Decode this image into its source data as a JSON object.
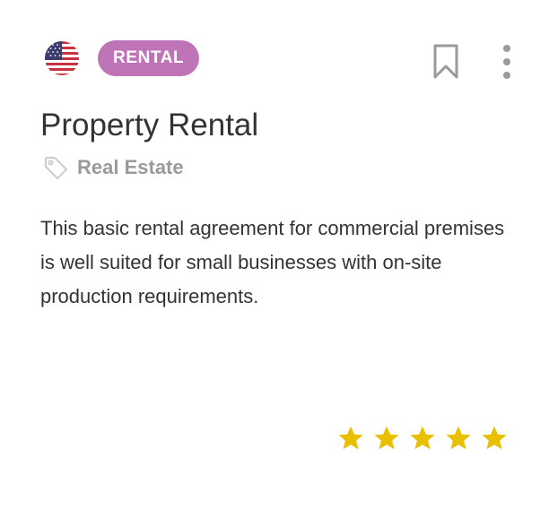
{
  "card": {
    "flag_icon": "us-flag-icon",
    "badge_label": "RENTAL",
    "title": "Property Rental",
    "category": "Real Estate",
    "description": "This basic rental agreement for commercial premises is well suited for small businesses with on-site production requirements.",
    "rating": {
      "value": 5,
      "max": 5
    }
  },
  "colors": {
    "badge": "#c074b8",
    "star": "#e8c000",
    "icon_gray": "#9a9a9a"
  }
}
